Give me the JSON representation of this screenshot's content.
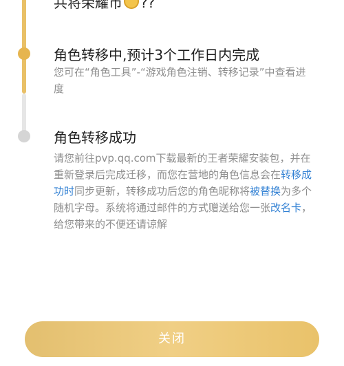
{
  "top_clipped": {
    "text": "共将荣耀币",
    "suffix": "??",
    "coin_icon": "coin-icon"
  },
  "steps": [
    {
      "title": "角色转移中,预计3个工作日内完成",
      "description": "您可在“角色工具”-“游戏角色注销、转移记录”中查看进度",
      "status_color": "#e6b54f"
    },
    {
      "title": "角色转移成功",
      "description": {
        "part1": "请您前往pvp.qq.com下载最新的王者荣耀安装包，并在重新登录后完成迁移，而您在营地的角色信息会在",
        "link1": "转移成功时",
        "part2": "同步更新，转移成功后您的角色昵称将",
        "link2": "被替换",
        "part3": "为多个随机字母。系统将通过邮件的方式赠送给您一张",
        "link3": "改名卡",
        "part4": "，给您带来的不便还请谅解"
      },
      "status_color": "#d5d5d5"
    }
  ],
  "close_button": {
    "label": "关闭"
  },
  "colors": {
    "gold": "#e9c067",
    "link": "#2f7fd3",
    "muted_text": "#8e8e8e"
  }
}
